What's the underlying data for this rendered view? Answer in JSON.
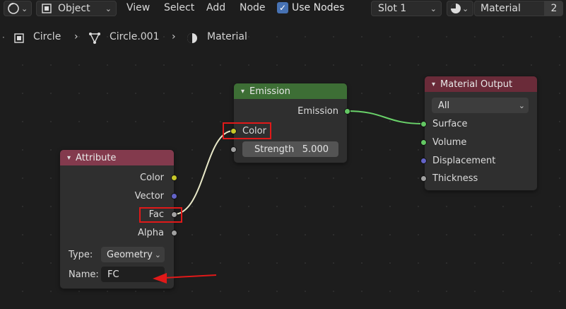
{
  "header": {
    "object_mode_label": "Object",
    "menu": [
      "View",
      "Select",
      "Add",
      "Node"
    ],
    "use_nodes_label": "Use Nodes",
    "slot_label": "Slot 1",
    "material_name": "Material",
    "user_count": "2"
  },
  "breadcrumb": [
    "Circle",
    "Circle.001",
    "Material"
  ],
  "nodes": {
    "attribute": {
      "title": "Attribute",
      "outputs": [
        "Color",
        "Vector",
        "Fac",
        "Alpha"
      ],
      "type_label": "Type:",
      "type_value": "Geometry",
      "name_label": "Name:",
      "name_value": "FC"
    },
    "emission": {
      "title": "Emission",
      "output": "Emission",
      "input_color": "Color",
      "strength_label": "Strength",
      "strength_value": "5.000"
    },
    "material_output": {
      "title": "Material Output",
      "target": "All",
      "inputs": [
        "Surface",
        "Volume",
        "Displacement",
        "Thickness"
      ]
    }
  },
  "colors": {
    "attribute_header": "#833a4d",
    "emission_header": "#3d6e35",
    "output_header": "#6a2b39",
    "highlight": "#e01919",
    "link_fac": "#e8e8c8",
    "link_emission": "#6ad36a"
  }
}
